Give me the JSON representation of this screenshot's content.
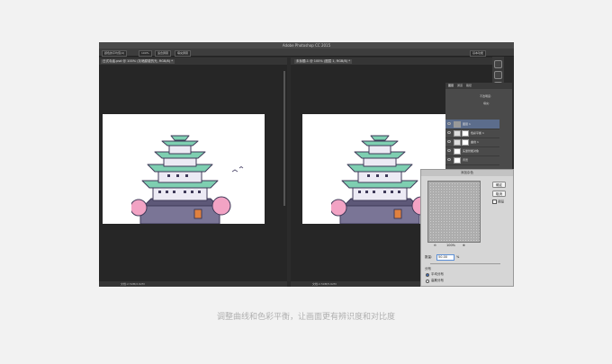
{
  "app": {
    "title": "Adobe Photoshop CC 2015"
  },
  "options_bar": {
    "buttons": [
      "颜色的平均值(4)",
      "100%",
      "适合屏幕",
      "填充屏幕"
    ],
    "workspace": "基本功能"
  },
  "left_doc": {
    "tab": "日式寺庙.psd @ 100% (灰暗朦胧的光, RGB/8) *",
    "status": "文档:2.59M/2.62M"
  },
  "right_doc": {
    "tab": "未标题-1 @ 100% (图层 1, RGB/8) *",
    "status": "文档:2.59M/5.62M"
  },
  "layers_panel": {
    "tabs": [
      "图层",
      "通道",
      "路径"
    ],
    "opacity_label": "不透明度:",
    "fill_label": "填充:",
    "layers": [
      {
        "name": "图层 1",
        "selected": true
      },
      {
        "name": "色彩平衡 1",
        "selected": false
      },
      {
        "name": "曲线 1",
        "selected": false
      },
      {
        "name": "矢量智能对象",
        "selected": false
      },
      {
        "name": "背景",
        "selected": false
      }
    ]
  },
  "noise_dialog": {
    "title": "添加杂色",
    "ok": "确定",
    "cancel": "取消",
    "preview_label": "预览",
    "zoom": "100%",
    "amount_label": "数量:",
    "amount_value": "50.00",
    "amount_unit": "%",
    "distribution_label": "分布",
    "option_uniform": "平均分布",
    "option_gaussian": "高斯分布"
  },
  "caption": "调整曲线和色彩平衡，让画面更有辨识度和对比度",
  "colors": {
    "page_bg": "#f2f2f2",
    "ps_bg": "#2b2b2b",
    "roof": "#7ecfb1",
    "roof_dark": "#3f3a59",
    "blossom": "#f2a3c4",
    "stone": "#7a7596",
    "selected_layer": "#5c6d8c"
  }
}
